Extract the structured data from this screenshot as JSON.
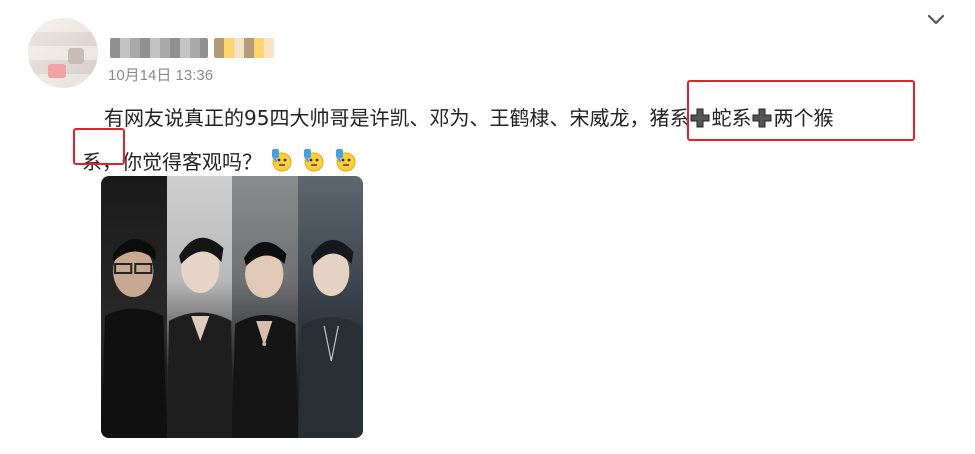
{
  "post": {
    "timestamp": "10月14日 13:36",
    "text_line1_a": "有网友说真正的95四大帅哥是许凯、邓为、王鹤棣、宋威龙，",
    "text_line1_b": "猪系",
    "text_line1_c": "蛇系",
    "text_line1_d": "两个猴",
    "text_line2_a": "系",
    "text_line2_b": "，你觉得客观吗？"
  },
  "icons": {
    "expand": "chevron-down-icon",
    "plus": "heavy-plus-icon",
    "emoji": "thinking-emoji-icon"
  },
  "colors": {
    "highlight": "#e4202a",
    "text": "#222222",
    "timestamp": "#8a8a8a"
  }
}
